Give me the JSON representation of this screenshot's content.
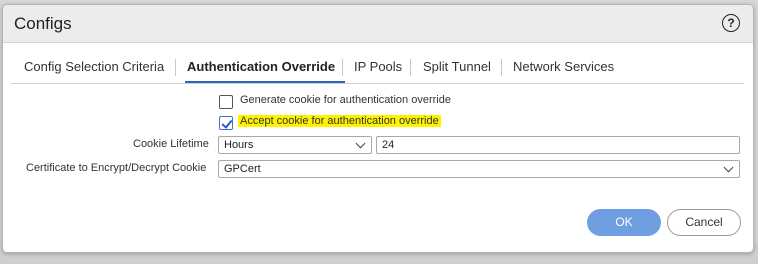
{
  "dialog": {
    "title": "Configs",
    "help_icon": "question-circle-icon",
    "help_glyph": "?"
  },
  "tabs": [
    {
      "label": "Config Selection Criteria",
      "active": false
    },
    {
      "label": "Authentication Override",
      "active": true
    },
    {
      "label": "IP Pools",
      "active": false
    },
    {
      "label": "Split Tunnel",
      "active": false
    },
    {
      "label": "Network Services",
      "active": false
    }
  ],
  "form": {
    "generate_cookie": {
      "label": "Generate cookie for authentication override",
      "checked": false
    },
    "accept_cookie": {
      "label": "Accept cookie for authentication override",
      "checked": true,
      "highlight_color": "#fff200"
    },
    "cookie_lifetime": {
      "label": "Cookie Lifetime",
      "unit": "Hours",
      "value": "24"
    },
    "certificate": {
      "label": "Certificate to Encrypt/Decrypt Cookie",
      "value": "GPCert"
    }
  },
  "buttons": {
    "ok": "OK",
    "cancel": "Cancel"
  },
  "colors": {
    "accent": "#2a64c5",
    "ok_button": "#6f9ee3"
  }
}
